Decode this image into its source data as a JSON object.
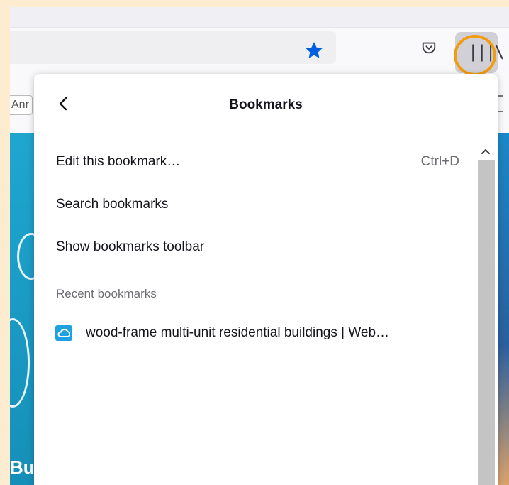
{
  "toolbar": {
    "bookmarks_strip_partial": "Anr"
  },
  "panel": {
    "title": "Bookmarks",
    "items": [
      {
        "label": "Edit this bookmark…",
        "shortcut": "Ctrl+D"
      },
      {
        "label": "Search bookmarks"
      },
      {
        "label": "Show bookmarks toolbar"
      }
    ],
    "recent_section_label": "Recent bookmarks",
    "recent": [
      {
        "label": "wood-frame multi-unit residential buildings | Web…",
        "icon": "cloud-favicon-icon"
      }
    ]
  },
  "page": {
    "partial_text": "Bu"
  },
  "colors": {
    "accent_star": "#0060df",
    "highlight_ring": "#f39c12",
    "page_background": "#1f9fc7",
    "scroll_thumb": "#c4c4c4",
    "outer_background": "#fdeccf"
  }
}
